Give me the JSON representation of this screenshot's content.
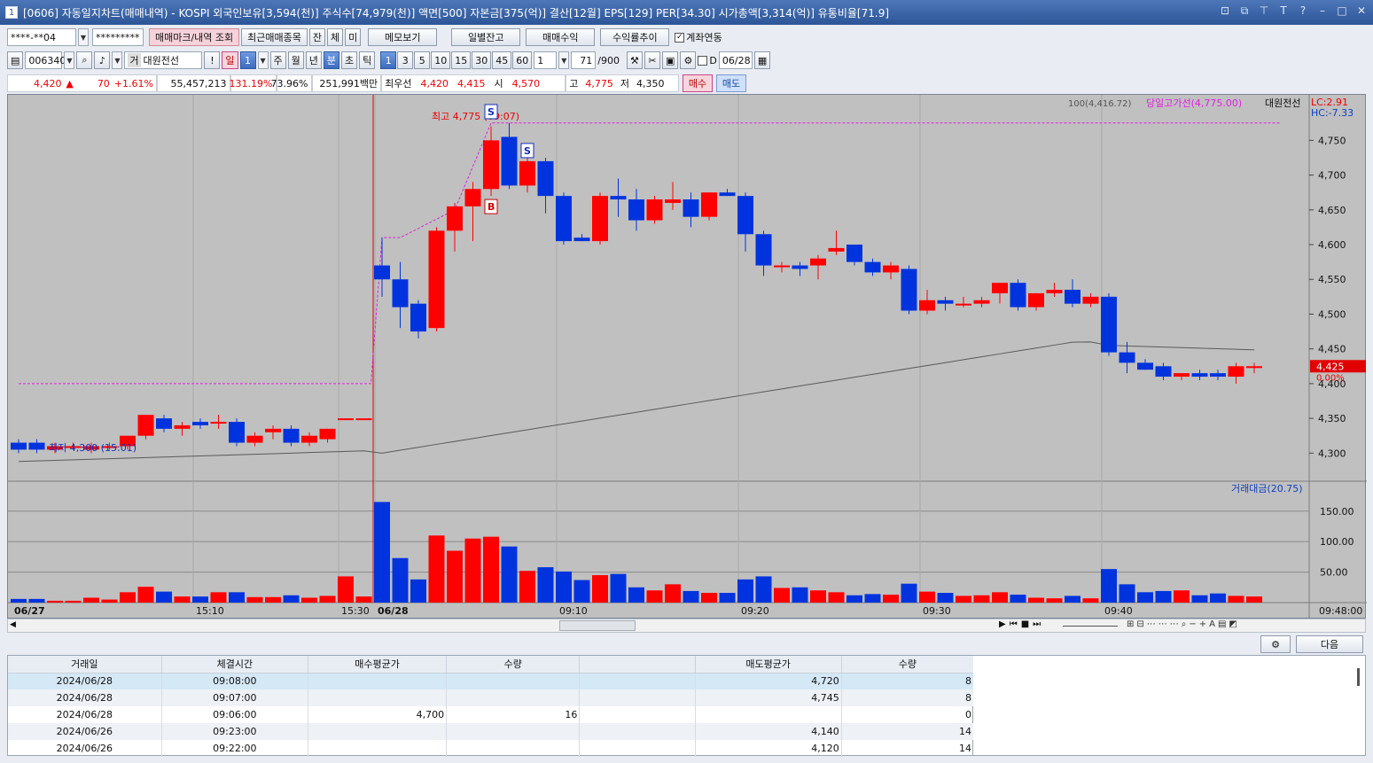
{
  "window": {
    "number": "1",
    "title": "[0606] 자동일지차트(매매내역) - KOSPI 외국인보유[3,594(천)] 주식수[74,979(천)] 액면[500] 자본금[375(억)] 결산[12월] EPS[129] PER[34.30] 시가총액[3,314(억)] 유통비율[71.9]"
  },
  "toolbar1": {
    "account": "****-**04",
    "password": "*********",
    "mark_btn": "매매마크/내역 조회",
    "recent_btn": "최근매매종목",
    "jan": "잔",
    "che": "체",
    "mi": "미",
    "memo": "메모보기",
    "daily": "일별잔고",
    "profit": "매매수익",
    "rate": "수익률추이",
    "link_label": "계좌연동"
  },
  "toolbar2": {
    "code": "006340",
    "gubun": "거",
    "name": "대원전선",
    "excl": "!",
    "il": "일",
    "il_n": "1",
    "ju": "주",
    "wol": "월",
    "nyeon": "년",
    "bun": "분",
    "cho": "초",
    "tik": "틱",
    "periods": [
      "1",
      "3",
      "5",
      "10",
      "15",
      "30",
      "45",
      "60"
    ],
    "count": "1",
    "n_val": "71",
    "n_max": "/900",
    "d_label": "D",
    "date": "06/28"
  },
  "quote": {
    "price": "4,420",
    "arrow": "▲",
    "change": "70",
    "pct": "+1.61%",
    "volume": "55,457,213",
    "vol_pct": "131.19%",
    "turn": "73.96%",
    "amount": "251,991백만",
    "priority_label": "최우선",
    "ask": "4,420",
    "bid": "4,415",
    "open_label": "시",
    "open": "4,570",
    "high_label": "고",
    "high": "4,775",
    "low_label": "저",
    "low": "4,350",
    "buy": "매수",
    "sell": "매도"
  },
  "chart": {
    "ma_label": "100(4,416.72)",
    "high_line_label": "당일고가선(4,775.00)",
    "stock_label": "대원전선",
    "lc": "LC:2.91",
    "hc": "HC:-7.33",
    "max_note": "최고 4,775 (09:07)",
    "min_note": "최저 4,300 (15:01)",
    "cur_price": "4,425",
    "cur_pct": "0.00%",
    "vol_title": "거래대금(20.75)",
    "price_ticks": [
      "4,750",
      "4,700",
      "4,650",
      "4,600",
      "4,550",
      "4,500",
      "4,450",
      "4,400",
      "4,350",
      "4,300"
    ],
    "vol_ticks": [
      "150.00",
      "100.00",
      "50.00"
    ],
    "time_labels": [
      "06/27",
      "15:10",
      "15:30",
      "06/28",
      "09:10",
      "09:20",
      "09:30",
      "09:40",
      "09:48:00"
    ],
    "colors": {
      "up": "#ff0000",
      "down": "#0033dd",
      "high_line": "#e020e0",
      "ma": "#5a5a5a",
      "bg": "#c0c0c0"
    }
  },
  "chart_data": {
    "type": "candlestick",
    "candles": [
      {
        "t": "15:01",
        "o": 4315,
        "h": 4320,
        "l": 4300,
        "c": 4305,
        "v": 6
      },
      {
        "t": "15:02",
        "o": 4315,
        "h": 4320,
        "l": 4300,
        "c": 4305,
        "v": 6
      },
      {
        "t": "15:03",
        "o": 4305,
        "h": 4315,
        "l": 4300,
        "c": 4310,
        "v": 3
      },
      {
        "t": "15:04",
        "o": 4310,
        "h": 4315,
        "l": 4305,
        "c": 4310,
        "v": 3
      },
      {
        "t": "15:05",
        "o": 4305,
        "h": 4315,
        "l": 4300,
        "c": 4310,
        "v": 8
      },
      {
        "t": "15:06",
        "o": 4310,
        "h": 4315,
        "l": 4305,
        "c": 4310,
        "v": 5
      },
      {
        "t": "15:07",
        "o": 4310,
        "h": 4325,
        "l": 4305,
        "c": 4325,
        "v": 17
      },
      {
        "t": "15:08",
        "o": 4325,
        "h": 4355,
        "l": 4320,
        "c": 4355,
        "v": 26
      },
      {
        "t": "15:09",
        "o": 4350,
        "h": 4355,
        "l": 4330,
        "c": 4335,
        "v": 18
      },
      {
        "t": "15:10",
        "o": 4335,
        "h": 4345,
        "l": 4325,
        "c": 4340,
        "v": 10
      },
      {
        "t": "15:11",
        "o": 4345,
        "h": 4350,
        "l": 4335,
        "c": 4340,
        "v": 10
      },
      {
        "t": "15:12",
        "o": 4345,
        "h": 4355,
        "l": 4335,
        "c": 4345,
        "v": 17
      },
      {
        "t": "15:13",
        "o": 4345,
        "h": 4350,
        "l": 4310,
        "c": 4315,
        "v": 17
      },
      {
        "t": "15:14",
        "o": 4315,
        "h": 4330,
        "l": 4310,
        "c": 4325,
        "v": 9
      },
      {
        "t": "15:15",
        "o": 4330,
        "h": 4340,
        "l": 4320,
        "c": 4335,
        "v": 9
      },
      {
        "t": "15:16",
        "o": 4335,
        "h": 4340,
        "l": 4310,
        "c": 4315,
        "v": 12
      },
      {
        "t": "15:17",
        "o": 4315,
        "h": 4330,
        "l": 4310,
        "c": 4325,
        "v": 8
      },
      {
        "t": "15:18",
        "o": 4320,
        "h": 4335,
        "l": 4315,
        "c": 4335,
        "v": 11
      },
      {
        "t": "15:30",
        "o": 4350,
        "h": 4350,
        "l": 4350,
        "c": 4350,
        "v": 43
      },
      {
        "t": "15:31",
        "o": 4350,
        "h": 4350,
        "l": 4350,
        "c": 4350,
        "v": 10
      },
      {
        "t": "09:00",
        "o": 4570,
        "h": 4610,
        "l": 4525,
        "c": 4550,
        "v": 165
      },
      {
        "t": "09:01",
        "o": 4550,
        "h": 4575,
        "l": 4480,
        "c": 4510,
        "v": 73
      },
      {
        "t": "09:02",
        "o": 4515,
        "h": 4520,
        "l": 4465,
        "c": 4475,
        "v": 38
      },
      {
        "t": "09:03",
        "o": 4480,
        "h": 4625,
        "l": 4475,
        "c": 4620,
        "v": 110
      },
      {
        "t": "09:04",
        "o": 4620,
        "h": 4660,
        "l": 4590,
        "c": 4655,
        "v": 85
      },
      {
        "t": "09:05",
        "o": 4655,
        "h": 4690,
        "l": 4605,
        "c": 4680,
        "v": 105
      },
      {
        "t": "09:06",
        "o": 4680,
        "h": 4770,
        "l": 4670,
        "c": 4750,
        "v": 108
      },
      {
        "t": "09:07",
        "o": 4755,
        "h": 4775,
        "l": 4680,
        "c": 4685,
        "v": 92
      },
      {
        "t": "09:08",
        "o": 4685,
        "h": 4725,
        "l": 4675,
        "c": 4720,
        "v": 52
      },
      {
        "t": "09:09",
        "o": 4720,
        "h": 4725,
        "l": 4645,
        "c": 4670,
        "v": 58
      },
      {
        "t": "09:10",
        "o": 4670,
        "h": 4675,
        "l": 4600,
        "c": 4605,
        "v": 51
      },
      {
        "t": "09:11",
        "o": 4610,
        "h": 4615,
        "l": 4605,
        "c": 4605,
        "v": 37
      },
      {
        "t": "09:12",
        "o": 4605,
        "h": 4675,
        "l": 4600,
        "c": 4670,
        "v": 45
      },
      {
        "t": "09:13",
        "o": 4670,
        "h": 4695,
        "l": 4640,
        "c": 4665,
        "v": 47
      },
      {
        "t": "09:14",
        "o": 4665,
        "h": 4680,
        "l": 4620,
        "c": 4635,
        "v": 25
      },
      {
        "t": "09:15",
        "o": 4635,
        "h": 4670,
        "l": 4630,
        "c": 4665,
        "v": 20
      },
      {
        "t": "09:16",
        "o": 4660,
        "h": 4690,
        "l": 4650,
        "c": 4665,
        "v": 30
      },
      {
        "t": "09:17",
        "o": 4665,
        "h": 4675,
        "l": 4625,
        "c": 4640,
        "v": 19
      },
      {
        "t": "09:18",
        "o": 4640,
        "h": 4675,
        "l": 4635,
        "c": 4675,
        "v": 16
      },
      {
        "t": "09:19",
        "o": 4675,
        "h": 4680,
        "l": 4670,
        "c": 4670,
        "v": 16
      },
      {
        "t": "09:20",
        "o": 4670,
        "h": 4675,
        "l": 4590,
        "c": 4615,
        "v": 38
      },
      {
        "t": "09:21",
        "o": 4615,
        "h": 4620,
        "l": 4555,
        "c": 4570,
        "v": 43
      },
      {
        "t": "09:22",
        "o": 4570,
        "h": 4575,
        "l": 4560,
        "c": 4570,
        "v": 24
      },
      {
        "t": "09:23",
        "o": 4570,
        "h": 4575,
        "l": 4555,
        "c": 4565,
        "v": 25
      },
      {
        "t": "09:24",
        "o": 4570,
        "h": 4585,
        "l": 4550,
        "c": 4580,
        "v": 20
      },
      {
        "t": "09:25",
        "o": 4590,
        "h": 4620,
        "l": 4585,
        "c": 4595,
        "v": 17
      },
      {
        "t": "09:26",
        "o": 4600,
        "h": 4600,
        "l": 4570,
        "c": 4575,
        "v": 12
      },
      {
        "t": "09:27",
        "o": 4575,
        "h": 4580,
        "l": 4555,
        "c": 4560,
        "v": 14
      },
      {
        "t": "09:28",
        "o": 4560,
        "h": 4575,
        "l": 4550,
        "c": 4570,
        "v": 13
      },
      {
        "t": "09:29",
        "o": 4565,
        "h": 4570,
        "l": 4500,
        "c": 4505,
        "v": 31
      },
      {
        "t": "09:30",
        "o": 4505,
        "h": 4535,
        "l": 4500,
        "c": 4520,
        "v": 18
      },
      {
        "t": "09:31",
        "o": 4520,
        "h": 4525,
        "l": 4505,
        "c": 4515,
        "v": 16
      },
      {
        "t": "09:32",
        "o": 4515,
        "h": 4525,
        "l": 4510,
        "c": 4515,
        "v": 11
      },
      {
        "t": "09:33",
        "o": 4515,
        "h": 4525,
        "l": 4510,
        "c": 4520,
        "v": 12
      },
      {
        "t": "09:34",
        "o": 4530,
        "h": 4545,
        "l": 4515,
        "c": 4545,
        "v": 17
      },
      {
        "t": "09:35",
        "o": 4545,
        "h": 4550,
        "l": 4505,
        "c": 4510,
        "v": 13
      },
      {
        "t": "09:36",
        "o": 4510,
        "h": 4530,
        "l": 4505,
        "c": 4530,
        "v": 8
      },
      {
        "t": "09:37",
        "o": 4530,
        "h": 4545,
        "l": 4525,
        "c": 4535,
        "v": 7
      },
      {
        "t": "09:38",
        "o": 4535,
        "h": 4550,
        "l": 4510,
        "c": 4515,
        "v": 11
      },
      {
        "t": "09:39",
        "o": 4515,
        "h": 4530,
        "l": 4510,
        "c": 4525,
        "v": 7
      },
      {
        "t": "09:40",
        "o": 4525,
        "h": 4530,
        "l": 4440,
        "c": 4445,
        "v": 55
      },
      {
        "t": "09:41",
        "o": 4445,
        "h": 4460,
        "l": 4415,
        "c": 4430,
        "v": 30
      },
      {
        "t": "09:42",
        "o": 4430,
        "h": 4435,
        "l": 4420,
        "c": 4420,
        "v": 17
      },
      {
        "t": "09:43",
        "o": 4425,
        "h": 4430,
        "l": 4405,
        "c": 4410,
        "v": 19
      },
      {
        "t": "09:44",
        "o": 4410,
        "h": 4415,
        "l": 4405,
        "c": 4415,
        "v": 20
      },
      {
        "t": "09:45",
        "o": 4415,
        "h": 4420,
        "l": 4405,
        "c": 4410,
        "v": 12
      },
      {
        "t": "09:46",
        "o": 4415,
        "h": 4420,
        "l": 4405,
        "c": 4410,
        "v": 15
      },
      {
        "t": "09:47",
        "o": 4410,
        "h": 4430,
        "l": 4400,
        "c": 4425,
        "v": 11
      },
      {
        "t": "09:48",
        "o": 4425,
        "h": 4430,
        "l": 4415,
        "c": 4425,
        "v": 10
      }
    ],
    "ylim": [
      4280,
      4790
    ],
    "vol_ylim": [
      0,
      170
    ]
  },
  "trades": {
    "headers": [
      "거래일",
      "체결시간",
      "매수평균가",
      "수량",
      "",
      "매도평균가",
      "수량"
    ],
    "rows": [
      [
        "2024/06/28",
        "09:08:00",
        "",
        "",
        "",
        "4,720",
        "8"
      ],
      [
        "2024/06/28",
        "09:07:00",
        "",
        "",
        "",
        "4,745",
        "8"
      ],
      [
        "2024/06/28",
        "09:06:00",
        "4,700",
        "16",
        "",
        "",
        "0"
      ],
      [
        "2024/06/26",
        "09:23:00",
        "",
        "",
        "",
        "4,140",
        "14"
      ],
      [
        "2024/06/26",
        "09:22:00",
        "",
        "",
        "",
        "4,120",
        "14"
      ]
    ]
  },
  "bottom": {
    "next": "다음"
  }
}
